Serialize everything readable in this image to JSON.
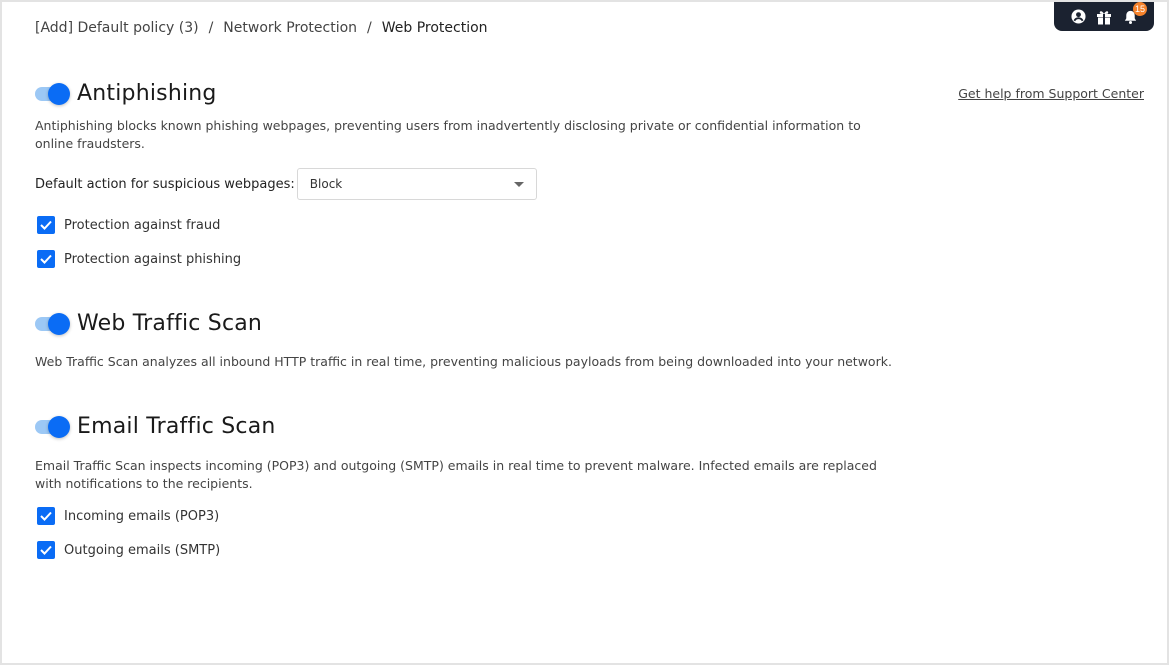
{
  "header": {
    "breadcrumb": [
      "[Add] Default policy (3)",
      "Network Protection",
      "Web Protection"
    ],
    "breadcrumb_separator": "/",
    "icons": [
      "user-icon",
      "gift-icon",
      "bell-icon"
    ],
    "notifications_count": "15",
    "help_link": "Get help from Support Center"
  },
  "colors": {
    "accent": "#0a6cf5",
    "toggle_track": "#9cc8f5",
    "badge": "#f5822b",
    "topbar": "#1b2230"
  },
  "sections": [
    {
      "title": "Antiphishing",
      "enabled": true,
      "description": "Antiphishing blocks known phishing webpages, preventing users from inadvertently disclosing private or confidential information to online fraudsters.",
      "field": {
        "label": "Default action for suspicious webpages:",
        "value": "Block"
      },
      "options": [
        {
          "label": "Protection against fraud",
          "checked": true
        },
        {
          "label": "Protection against phishing",
          "checked": true
        }
      ]
    },
    {
      "title": "Web Traffic Scan",
      "enabled": true,
      "description": "Web Traffic Scan analyzes all inbound HTTP traffic in real time, preventing malicious payloads from being downloaded into your network."
    },
    {
      "title": "Email Traffic Scan",
      "enabled": true,
      "description": "Email Traffic Scan inspects incoming (POP3) and outgoing (SMTP) emails in real time to prevent malware. Infected emails are replaced with notifications to the recipients.",
      "options": [
        {
          "label": "Incoming emails (POP3)",
          "checked": true
        },
        {
          "label": "Outgoing emails (SMTP)",
          "checked": true
        }
      ]
    }
  ]
}
